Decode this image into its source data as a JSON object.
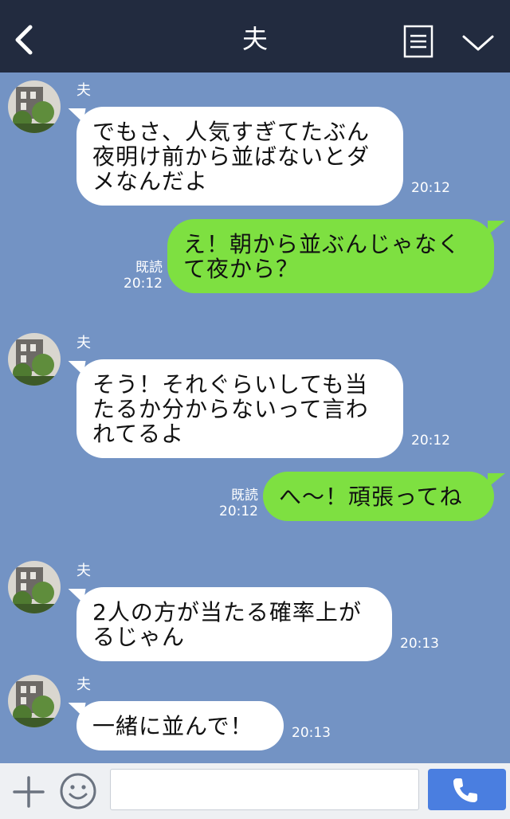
{
  "header": {
    "title": "夫",
    "back_icon": "chevron-left-icon",
    "notes_icon": "notes-icon",
    "menu_icon": "chevron-down-icon"
  },
  "messages": [
    {
      "side": "in",
      "sender": "夫",
      "text": "でもさ、人気すぎてたぶん\n夜明け前から並ばないとダ\nメなんだよ",
      "time": "20:12"
    },
    {
      "side": "out",
      "read": "既読",
      "text": "え！朝から並ぶんじゃなく\nて夜から？",
      "time": "20:12"
    },
    {
      "side": "in",
      "sender": "夫",
      "text": "そう！それぐらいしても当\nたるか分からないって言わ\nれてるよ",
      "time": "20:12"
    },
    {
      "side": "out",
      "read": "既読",
      "text": "へ〜！頑張ってね",
      "time": "20:12"
    },
    {
      "side": "in",
      "sender": "夫",
      "text": "2人の方が当たる確率上が\nるじゃん",
      "time": "20:13"
    },
    {
      "side": "in",
      "sender": "夫",
      "text": "一緒に並んで！",
      "time": "20:13"
    }
  ],
  "composer": {
    "placeholder": "",
    "plus_icon": "plus-icon",
    "emoji_icon": "emoji-icon",
    "call_icon": "phone-icon"
  },
  "colors": {
    "header_bg": "#222b3f",
    "chat_bg": "#7393c4",
    "outgoing_bubble": "#7ee041",
    "incoming_bubble": "#ffffff",
    "call_button": "#4a7ee0"
  }
}
